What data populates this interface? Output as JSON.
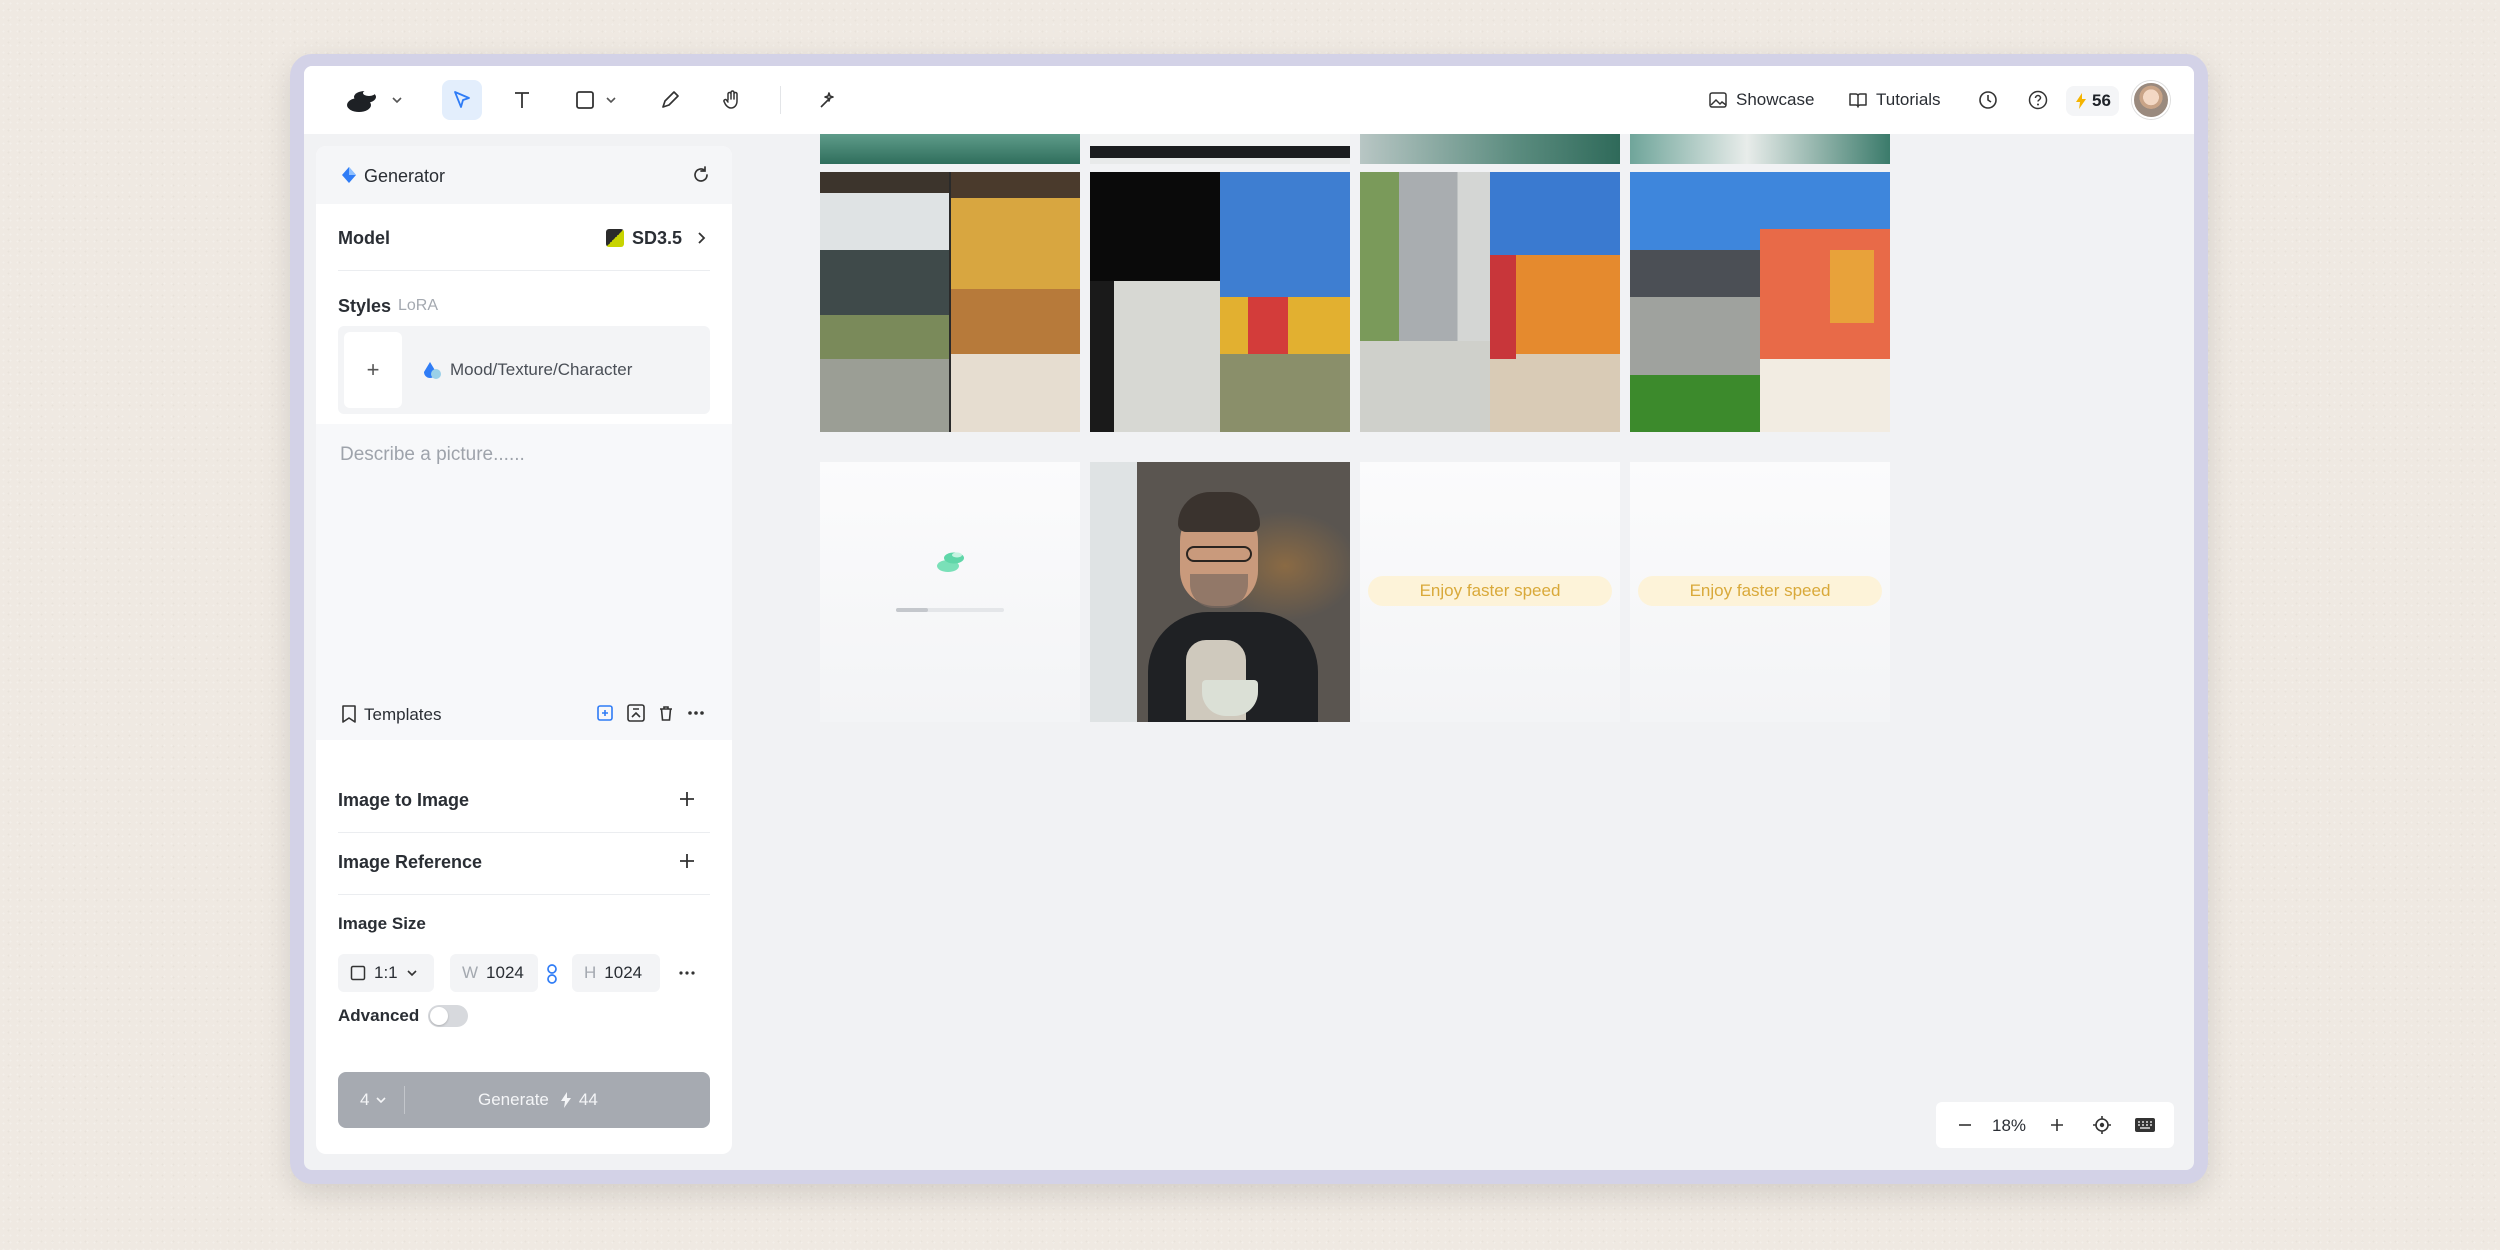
{
  "toolbar": {
    "showcase_label": "Showcase",
    "tutorials_label": "Tutorials",
    "credits": "56"
  },
  "generator": {
    "title": "Generator",
    "model_label": "Model",
    "model_value": "SD3.5",
    "styles_label": "Styles",
    "lora_label": "LoRA",
    "style_placeholder": "Mood/Texture/Character",
    "prompt_placeholder": "Describe a picture......",
    "templates_label": "Templates",
    "image_to_image_label": "Image to Image",
    "image_reference_label": "Image Reference",
    "image_size_label": "Image Size",
    "ratio": "1:1",
    "width_prefix": "W",
    "width": "1024",
    "height_prefix": "H",
    "height": "1024",
    "advanced_label": "Advanced",
    "advanced_enabled": false,
    "batch_count": "4",
    "generate_label": "Generate",
    "generate_cost": "44"
  },
  "canvas": {
    "enjoy_text": "Enjoy faster speed",
    "loading_progress": 0.3
  },
  "zoom": {
    "level": "18%"
  },
  "colors": {
    "accent": "#2f7cf6",
    "panel_bg": "#ffffff",
    "canvas_bg": "#f1f2f4",
    "generate_disabled": "#a6aab1",
    "enjoy_text": "#d9a93a",
    "credit_bolt": "#f5b400"
  }
}
